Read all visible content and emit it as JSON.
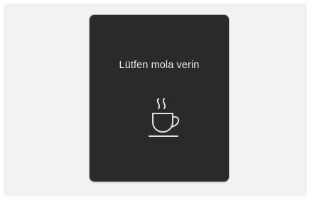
{
  "display": {
    "message": "Lütfen mola verin",
    "icon": "coffee-cup-icon"
  },
  "colors": {
    "background": "#f2f2f2",
    "panel": "#2a2a2a",
    "text": "#e9e9e9",
    "icon": "#e0e0e0"
  }
}
